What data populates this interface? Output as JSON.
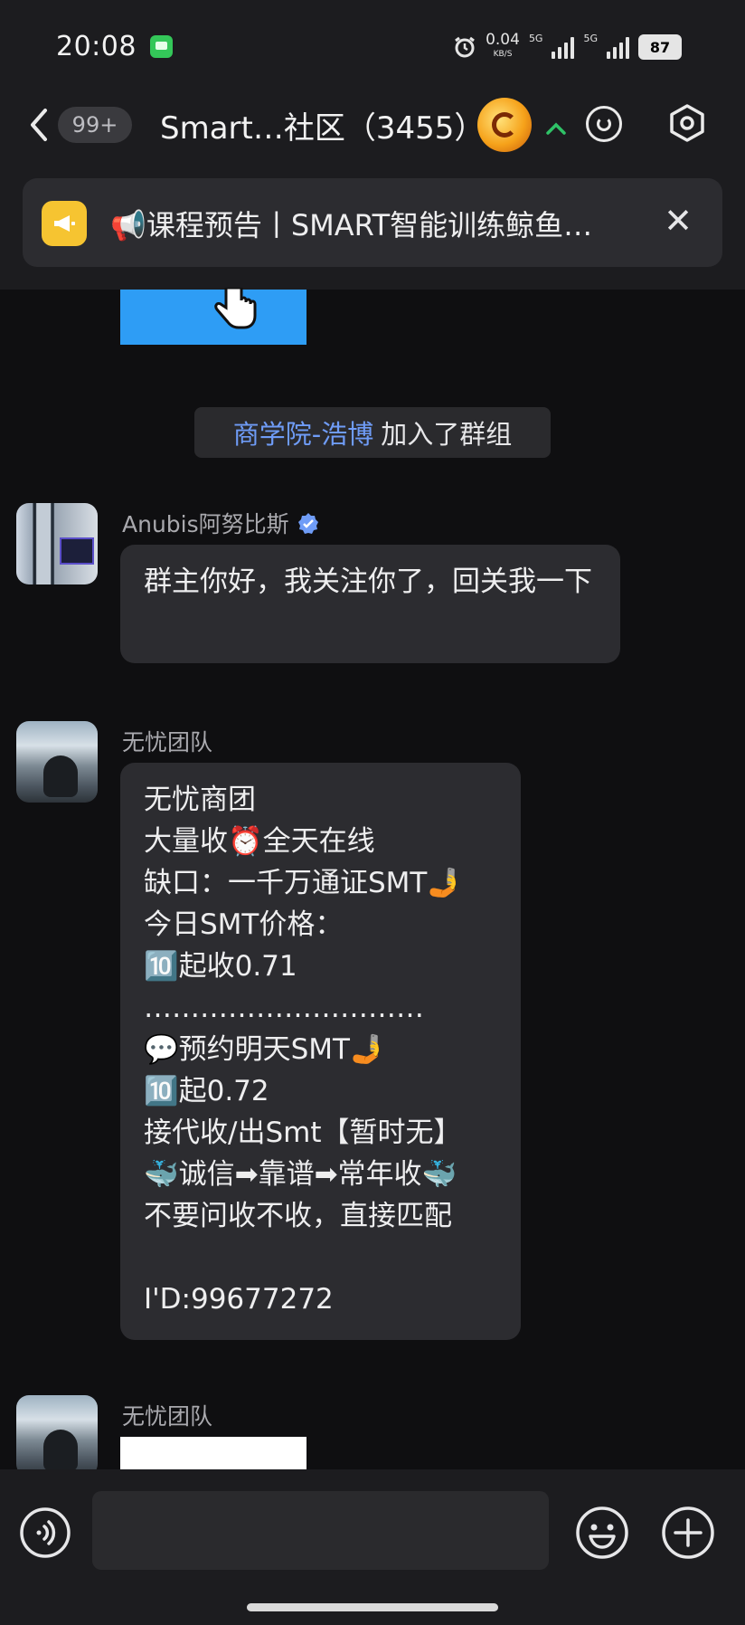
{
  "status_bar": {
    "time": "20:08",
    "net_speed": "0.04",
    "net_unit": "KB/S",
    "signal_1": "5G",
    "signal_2": "5G",
    "battery": "87"
  },
  "header": {
    "back_icon": "chevron-left-icon",
    "unread_badge": "99+",
    "title": "Smart…社区（3455）",
    "status_icon": "chevron-up-icon",
    "status_color": "#2fc267"
  },
  "notice": {
    "icon": "megaphone-icon",
    "text": "📢课程预告丨SMART智能训练鲸鱼…",
    "close": "✕"
  },
  "system_message": {
    "name": "商学院-浩博",
    "text": "加入了群组"
  },
  "messages": [
    {
      "sender": "Anubis阿努比斯",
      "verified": true,
      "text": "群主你好，我关注你了，回关我一下"
    },
    {
      "sender": "无忧团队",
      "lines": [
        "无忧商团",
        "大量收⏰全天在线",
        "缺口：一千万通证SMT🤳",
        "今日SMT价格：",
        "🔟起收0.71",
        "…………………………",
        "💬预约明天SMT🤳",
        "🔟起0.72",
        "接代收/出Smt【暂时无】",
        "🐳诚信➡靠谱➡常年收🐳",
        "不要问收不收，直接匹配",
        "",
        "I'D:99677272"
      ]
    },
    {
      "sender": "无忧团队"
    }
  ],
  "input": {
    "placeholder": ""
  },
  "colors": {
    "accent_link": "#6f9cf7",
    "notice_icon_bg": "#f6c431",
    "image_blue": "#2e9df5",
    "bubble_bg": "#2c2c30"
  }
}
